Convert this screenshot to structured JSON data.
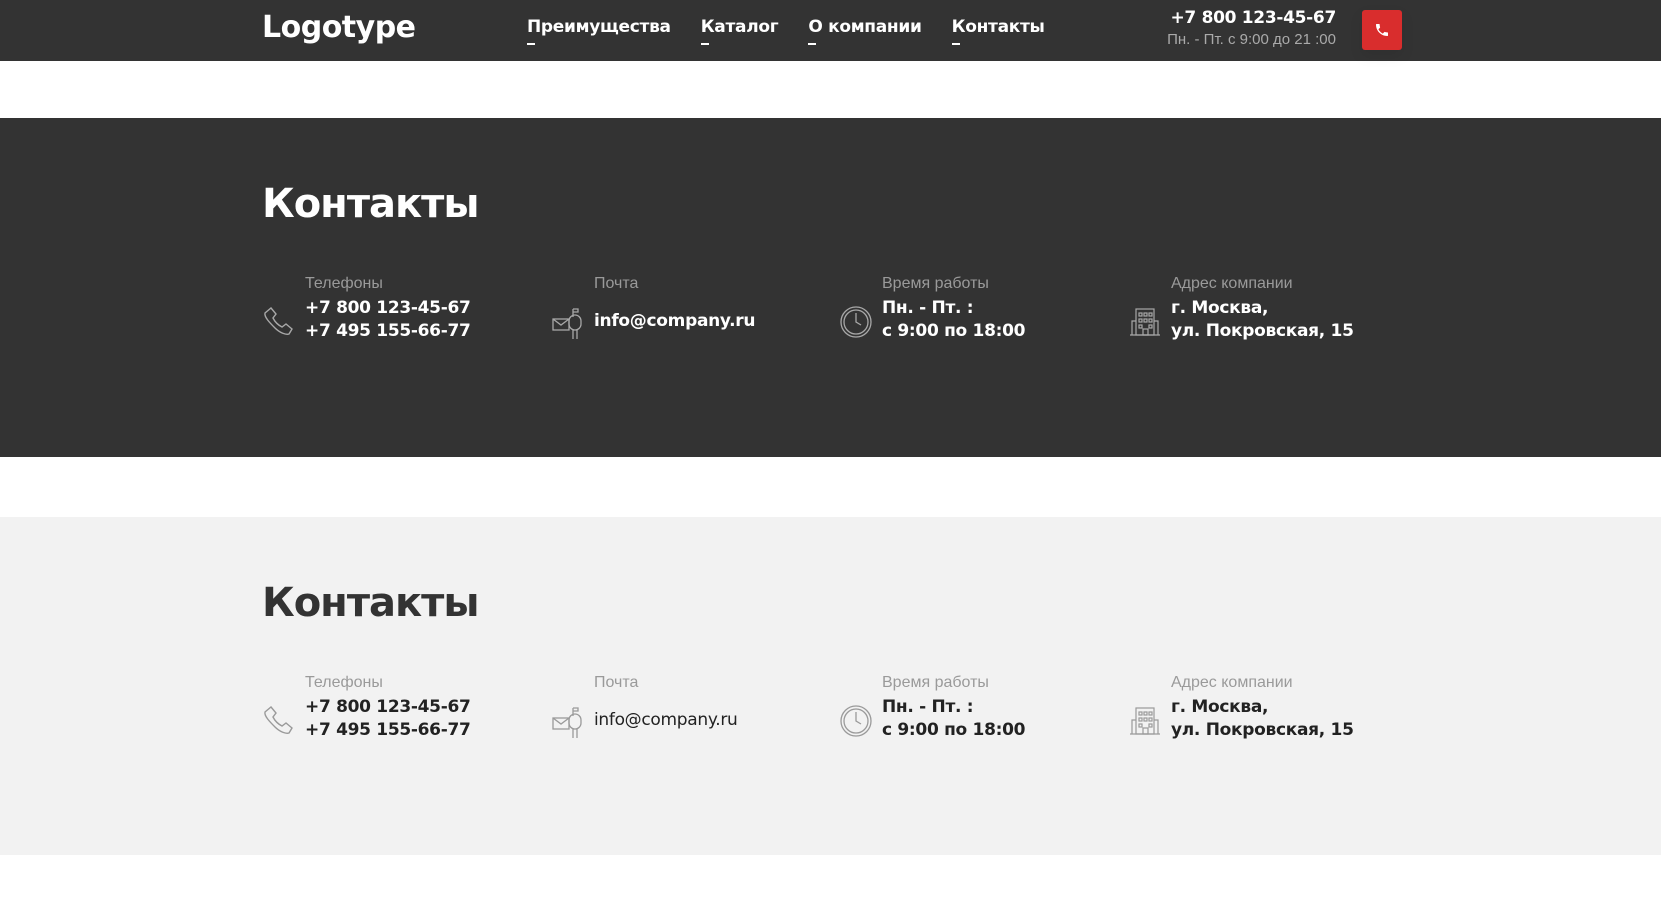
{
  "header": {
    "logo": "Logotype",
    "nav": [
      "Преимущества",
      "Каталог",
      "О компании",
      "Контакты"
    ],
    "phone": "+7 800 123-45-67",
    "hours": "Пн. - Пт. с 9:00 до 21 :00",
    "call_icon": "phone-icon"
  },
  "sections": [
    {
      "theme": "dark",
      "title": "Контакты",
      "phones_label": "Телефоны",
      "phone1": "+7 800 123-45-67",
      "phone2": "+7 495 155-66-77",
      "mail_label": "Почта",
      "mail": "info@company.ru",
      "hours_label": "Время работы",
      "hours1": "Пн. - Пт. :",
      "hours2": "с 9:00 по 18:00",
      "address_label": "Адрес компании",
      "address1": "г. Москва,",
      "address2": "ул. Покровская, 15"
    },
    {
      "theme": "light",
      "title": "Контакты",
      "phones_label": "Телефоны",
      "phone1": "+7 800 123-45-67",
      "phone2": "+7 495 155-66-77",
      "mail_label": "Почта",
      "mail": "info@company.ru",
      "hours_label": "Время работы",
      "hours1": "Пн. - Пт. :",
      "hours2": "с 9:00 по 18:00",
      "address_label": "Адрес компании",
      "address1": "г. Москва,",
      "address2": "ул. Покровская, 15"
    }
  ],
  "colors": {
    "dark_bg": "#333333",
    "light_bg": "#f2f2f2",
    "accent": "#d92d2d"
  }
}
